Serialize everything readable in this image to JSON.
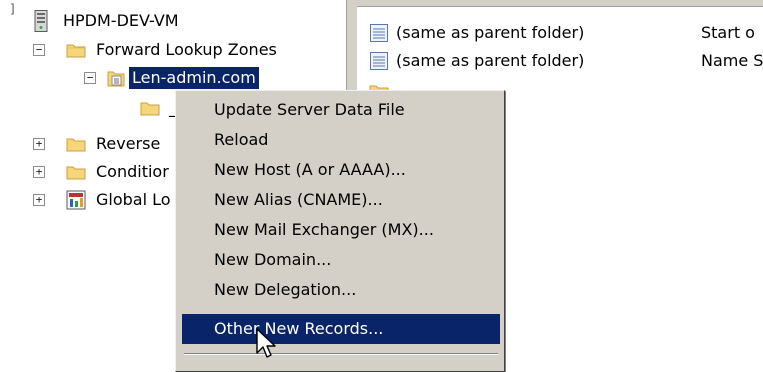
{
  "tree": {
    "server": "HPDM-DEV-VM",
    "forward_zones": "Forward Lookup Zones",
    "selected_zone": "Len-admin.com",
    "child_folder": "_",
    "reverse_zones": "Reverse",
    "conditional": "Conditior",
    "global_logs": "Global Lo",
    "expand_glyph": "+",
    "collapse_glyph": "−"
  },
  "list": {
    "rows": [
      {
        "name": "(same as parent folder)",
        "type": "Start o"
      },
      {
        "name": "(same as parent folder)",
        "type": "Name S"
      }
    ]
  },
  "context_menu": {
    "items": [
      "Update Server Data File",
      "Reload",
      "New Host (A or AAAA)...",
      "New Alias (CNAME)...",
      "New Mail Exchanger (MX)...",
      "New Domain...",
      "New Delegation...",
      "Other New Records..."
    ],
    "highlighted_index": 7
  },
  "icons": {
    "server": "server-icon",
    "folder": "folder-icon",
    "zone": "zone-file-icon",
    "record": "dns-record-icon",
    "cursor": "mouse-pointer-icon"
  },
  "colors": {
    "selection": "#0a246a",
    "menu_bg": "#d4d0c8",
    "folder": "#f5d77a"
  }
}
